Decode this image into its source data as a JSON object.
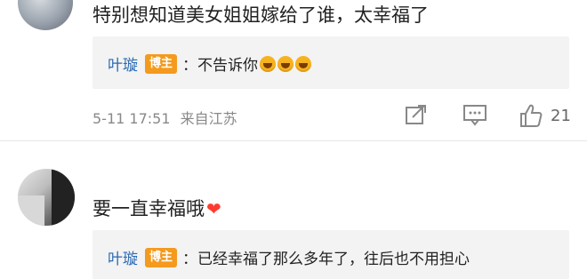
{
  "comment1": {
    "text": "特别想知道美女姐姐嫁给了谁，太幸福了",
    "reply": {
      "author": "叶璇",
      "badge": "博主",
      "text": "：不告诉你",
      "emojis": [
        "laugh-emoji",
        "laugh-emoji",
        "laugh-emoji"
      ]
    },
    "time": "5-11 17:51",
    "location": "来自江苏",
    "like_count": "21"
  },
  "comment2": {
    "text": "要一直幸福哦",
    "reply": {
      "author": "叶璇",
      "badge": "博主",
      "text": "：已经幸福了那么多年了，往后也不用担心"
    }
  },
  "colors": {
    "author": "#2a6ab3",
    "badge": "#f49a1e",
    "reply_bg": "#f3f3f3",
    "heart": "#ff3b30"
  }
}
